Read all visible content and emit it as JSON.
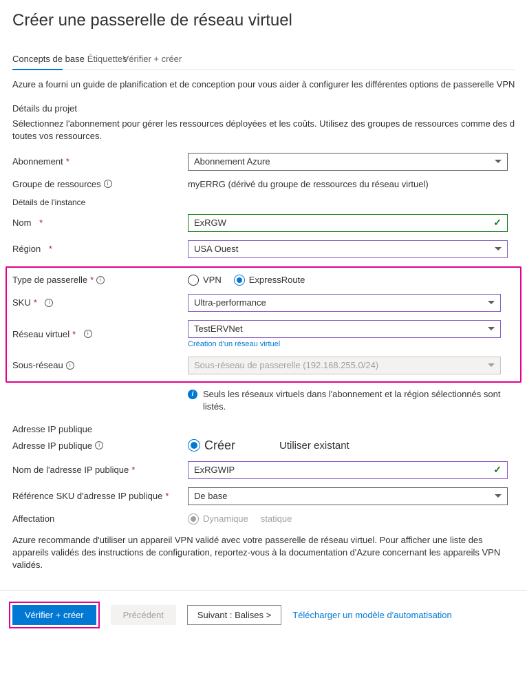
{
  "page_title": "Créer une passerelle de réseau virtuel",
  "tabs": {
    "basics": "Concepts de base",
    "tags": "Étiquettes",
    "review": "Vérifier + créer"
  },
  "intro": "Azure a fourni un guide de planification et de conception pour vous aider à configurer les différentes options de passerelle VPN. En savoi",
  "project_details": {
    "title": "Détails du projet",
    "desc": "Sélectionnez l'abonnement pour gérer les ressources déployées et les coûts. Utilisez des groupes de ressources comme des dossiers p",
    "desc2": "toutes vos ressources."
  },
  "fields": {
    "subscription_label": "Abonnement",
    "subscription_value": "Abonnement Azure",
    "rg_label": "Groupe de ressources",
    "rg_value": "myERRG (dérivé du groupe de ressources du réseau virtuel)"
  },
  "instance_details": {
    "title": "Détails de l'instance",
    "name_label": "Nom",
    "name_value": "ExRGW",
    "region_label": "Région",
    "region_value": "USA Ouest",
    "gwtype_label": "Type de passerelle",
    "gwtype_vpn": "VPN",
    "gwtype_er": "ExpressRoute",
    "sku_label": "SKU",
    "sku_value": "Ultra-performance",
    "vnet_label": "Réseau virtuel",
    "vnet_value": "TestERVNet",
    "vnet_link": "Création d'un réseau virtuel",
    "subnet_label": "Sous-réseau",
    "subnet_value": "Sous-réseau de passerelle (192.168.255.0/24)"
  },
  "info_note": "Seuls les réseaux virtuels dans l'abonnement et la région sélectionnés sont listés.",
  "pip": {
    "title": "Adresse IP publique",
    "pip_label": "Adresse IP publique",
    "pip_create": "Créer",
    "pip_existing": "Utiliser existant",
    "name_label": "Nom de l'adresse IP publique",
    "name_value": "ExRGWIP",
    "sku_label": "Référence SKU d'adresse IP publique",
    "sku_value": "De base",
    "assign_label": "Affectation",
    "assign_dyn": "Dynamique",
    "assign_stat": "statique"
  },
  "bottom_note": "Azure recommande d'utiliser un appareil VPN validé avec votre passerelle de réseau virtuel. Pour afficher une liste des appareils validés des instructions de configuration, reportez-vous à la documentation d'Azure concernant les appareils VPN validés.",
  "footer": {
    "review": "Vérifier + créer",
    "prev": "Précédent",
    "next": "Suivant : Balises >",
    "download": "Télécharger un modèle d'automatisation"
  }
}
